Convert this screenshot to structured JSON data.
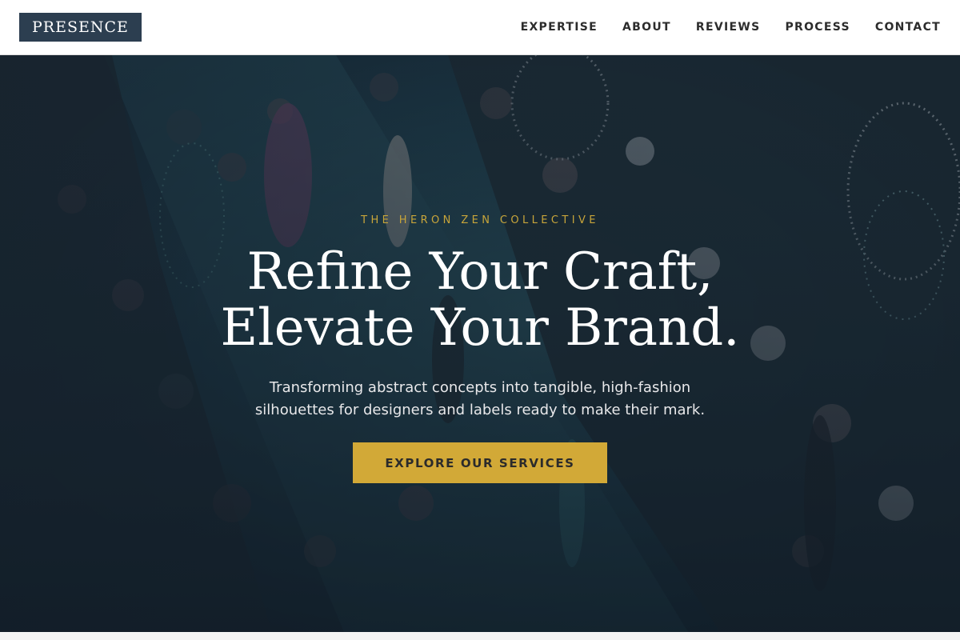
{
  "header": {
    "logo_text": "PRESENCE",
    "nav": [
      {
        "label": "EXPERTISE"
      },
      {
        "label": "ABOUT"
      },
      {
        "label": "REVIEWS"
      },
      {
        "label": "PROCESS"
      },
      {
        "label": "CONTACT"
      }
    ]
  },
  "hero": {
    "eyebrow": "THE HERON ZEN COLLECTIVE",
    "title_line1": "Refine Your Craft,",
    "title_line2": "Elevate Your Brand.",
    "subtitle": "Transforming abstract concepts into tangible, high-fashion silhouettes for designers and labels ready to make their mark.",
    "cta_label": "EXPLORE OUR SERVICES",
    "background_image": "fashion-runway-crowd-photo"
  },
  "colors": {
    "logo_bg": "#2c3e50",
    "accent_gold": "#d2a937",
    "eyebrow_gold": "#c8a53a",
    "nav_text": "#2c2c2c",
    "hero_text": "#ffffff"
  }
}
